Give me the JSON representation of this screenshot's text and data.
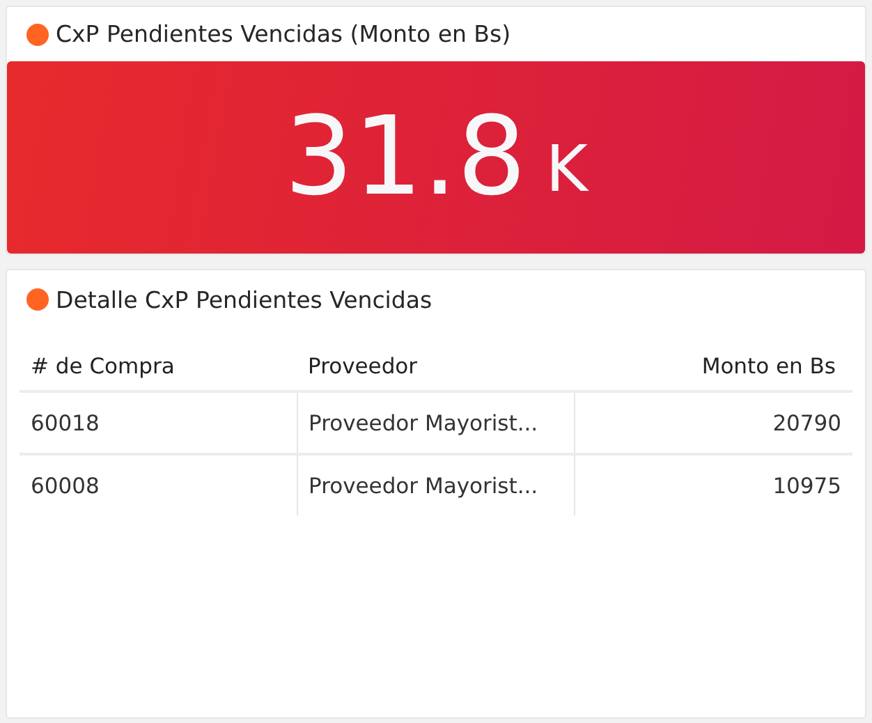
{
  "kpi_card": {
    "title": "CxP Pendientes Vencidas (Monto en Bs)",
    "value": "31.8",
    "unit": "K"
  },
  "detail_card": {
    "title": "Detalle CxP Pendientes Vencidas",
    "table": {
      "columns": [
        {
          "label": "# de Compra",
          "kind": "text"
        },
        {
          "label": "Proveedor",
          "kind": "text"
        },
        {
          "label": "Monto en Bs",
          "kind": "number"
        }
      ],
      "rows": [
        [
          "60018",
          "Proveedor Mayorist...",
          "20790"
        ],
        [
          "60008",
          "Proveedor Mayorist...",
          "10975"
        ]
      ]
    }
  }
}
